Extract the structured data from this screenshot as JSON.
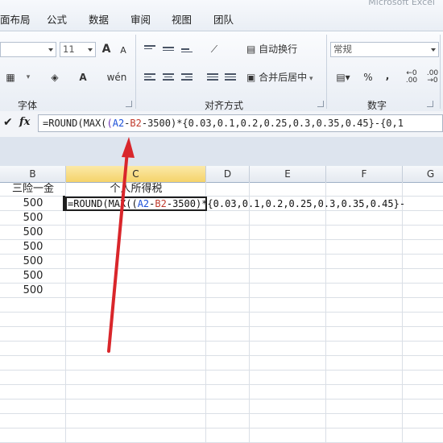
{
  "app": {
    "title_fragment": "Microsoft Excel"
  },
  "ribbon_tabs": [
    "页面布局",
    "公式",
    "数据",
    "审阅",
    "视图",
    "团队"
  ],
  "ribbon_tab_visible": [
    "面布局",
    "公式",
    "数据",
    "审阅",
    "视图",
    "团队"
  ],
  "ribbon": {
    "font_group": {
      "label": "字体",
      "font_size": "11",
      "grow_font": "A",
      "shrink_font": "A"
    },
    "alignment_group": {
      "label": "对齐方式",
      "wrap_text": "自动换行",
      "merge_center": "合并后居中"
    },
    "number_group": {
      "label": "数字",
      "format": "常规",
      "percent": "%",
      "comma": ","
    }
  },
  "formula_bar": {
    "fx": "fx",
    "content": "=ROUND(MAX((A2-B2-3500)*{0.03,0.1,0.2,0.25,0.3,0.35,0.45}-{0,1"
  },
  "sheet": {
    "columns": [
      "B",
      "C",
      "D",
      "E",
      "F",
      "G"
    ],
    "selected_column": "C",
    "header_row": {
      "B": "三险一金",
      "C": "个人所得税"
    },
    "b_values": [
      "500",
      "500",
      "500",
      "500",
      "500",
      "500",
      "500"
    ],
    "active_cell_text": "=ROUND(MAX((A2-B2-3500)*{0.03,0.1,0.2,0.25,0.3,0.35,0.45}-"
  },
  "colors": {
    "arrow": "#d9262b",
    "selected_header": "#f5d36a",
    "ref_A2": "#1b4fd8",
    "ref_B2": "#c0392b"
  }
}
